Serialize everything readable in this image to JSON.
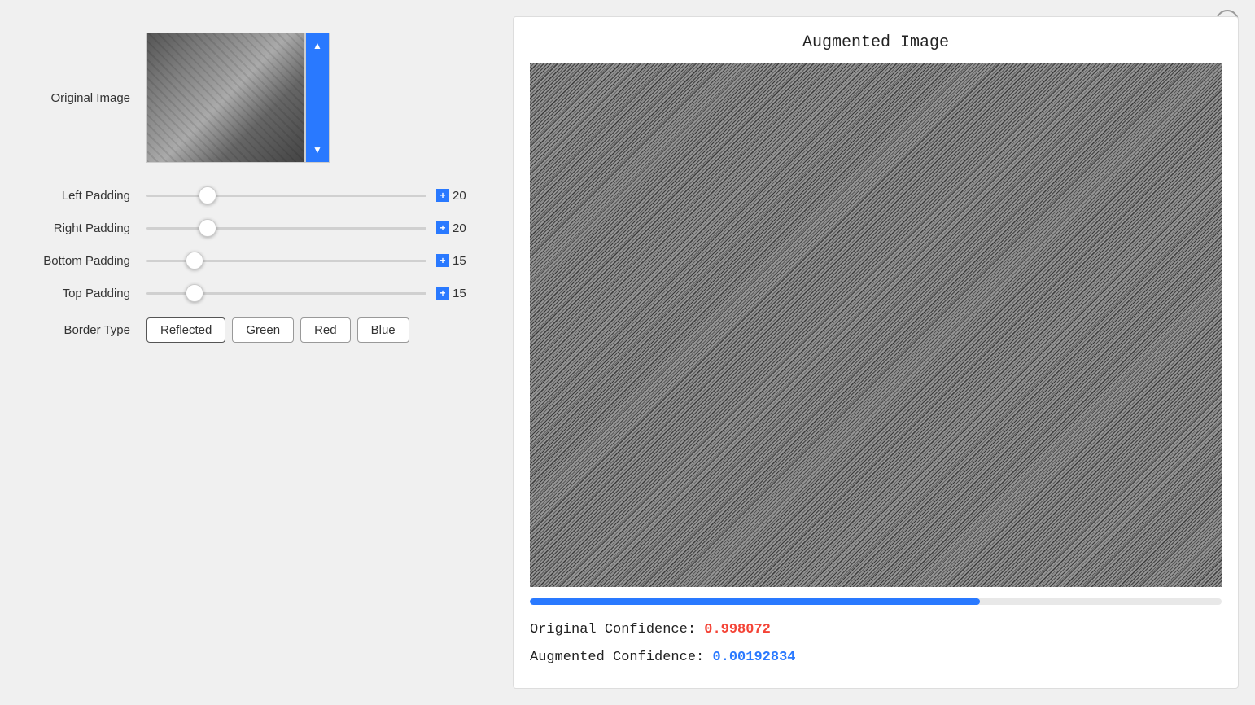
{
  "topbar": {
    "add_label": "⊕"
  },
  "left_panel": {
    "original_image_label": "Original Image",
    "sliders": [
      {
        "label": "Left Padding",
        "value": 20,
        "min": 0,
        "max": 100,
        "name": "left-padding-slider"
      },
      {
        "label": "Right Padding",
        "value": 20,
        "min": 0,
        "max": 100,
        "name": "right-padding-slider"
      },
      {
        "label": "Bottom Padding",
        "value": 15,
        "min": 0,
        "max": 100,
        "name": "bottom-padding-slider"
      },
      {
        "label": "Top Padding",
        "value": 15,
        "min": 0,
        "max": 100,
        "name": "top-padding-slider"
      }
    ],
    "border_type_label": "Border Type",
    "border_type_buttons": [
      {
        "label": "Reflected",
        "active": true
      },
      {
        "label": "Green",
        "active": false
      },
      {
        "label": "Red",
        "active": false
      },
      {
        "label": "Blue",
        "active": false
      }
    ]
  },
  "right_panel": {
    "title": "Augmented Image",
    "progress_percent": 65,
    "original_confidence_label": "Original Confidence:",
    "original_confidence_value": "0.998072",
    "augmented_confidence_label": "Augmented Confidence:",
    "augmented_confidence_value": "0.00192834"
  }
}
